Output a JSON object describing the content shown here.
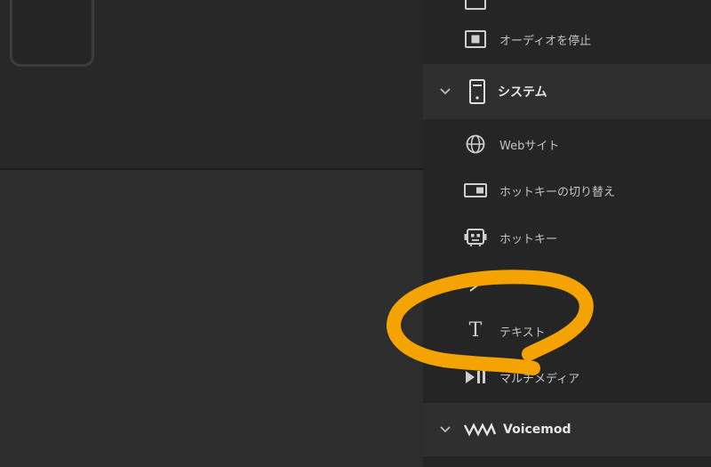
{
  "sidebar": {
    "items_top": [
      {
        "label": "オーディオを停止",
        "icon": "stop-audio-icon"
      }
    ],
    "category_system": {
      "label": "システム",
      "icon": "computer-tower-icon",
      "expanded": true
    },
    "system_items": [
      {
        "label": "Webサイト",
        "icon": "globe-icon"
      },
      {
        "label": "ホットキーの切り替え",
        "icon": "hotkey-toggle-icon"
      },
      {
        "label": "ホットキー",
        "icon": "robot-hotkey-icon"
      },
      {
        "label": "",
        "icon": "open-icon"
      },
      {
        "label": "テキスト",
        "icon": "text-icon"
      },
      {
        "label": "マルチメディア",
        "icon": "multimedia-icon"
      }
    ],
    "category_voicemod": {
      "label": "Voicemod",
      "icon": "voicemod-logo-icon",
      "expanded": true
    }
  },
  "annotation": {
    "color": "#f5a300"
  }
}
